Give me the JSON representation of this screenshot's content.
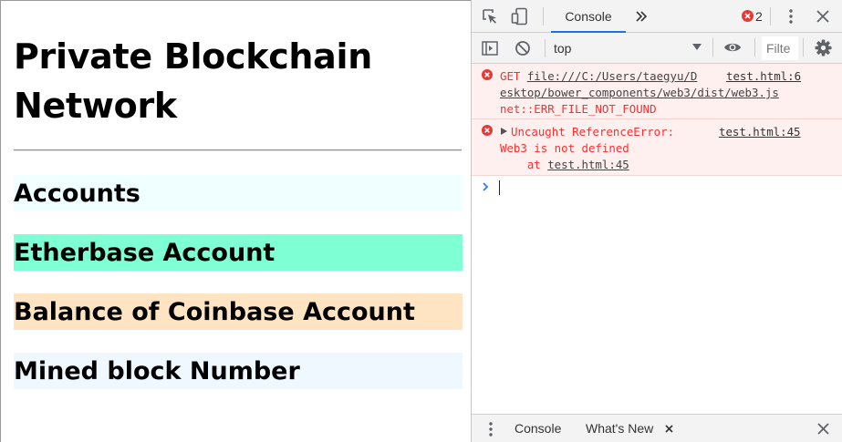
{
  "page": {
    "title_line1": "Private Blockchain",
    "title_line2": "Network",
    "sections": [
      {
        "label": "Accounts",
        "color": "#f0ffff"
      },
      {
        "label": "Etherbase Account",
        "color": "#7fffd4"
      },
      {
        "label": "Balance of Coinbase Account",
        "color": "#ffe4c4"
      },
      {
        "label": "Mined block Number",
        "color": "#f0f8ff"
      }
    ]
  },
  "devtools": {
    "main_tab": "Console",
    "error_count": "2",
    "context": "top",
    "filter_placeholder": "Filte",
    "accent_color": "#1a73e8",
    "error_color": "#fe2e2e",
    "messages": [
      {
        "line1_prefix": "GET ",
        "line1_url": "file:///C:/Users/taegyu/D",
        "line2_url": "esktop/bower_components/web3/dist/web3.js",
        "line3": "net::ERR_FILE_NOT_FOUND",
        "source1": "test.html:6"
      },
      {
        "line1": "Uncaught ReferenceError:",
        "line2": "Web3 is not defined",
        "line3_prefix": "    at ",
        "line3_link": "test.html:45",
        "source": "test.html:45"
      }
    ],
    "drawer": {
      "tab_console": "Console",
      "tab_whats_new": "What's New"
    },
    "icons": [
      "inspect-element-icon",
      "device-toolbar-icon",
      "more-tabs-icon",
      "error-icon",
      "kebab-menu-icon",
      "close-icon",
      "sidebar-toggle-icon",
      "clear-console-icon",
      "dropdown-arrow-icon",
      "eye-icon",
      "settings-gear-icon",
      "expand-triangle-icon",
      "prompt-chevron-icon"
    ]
  }
}
